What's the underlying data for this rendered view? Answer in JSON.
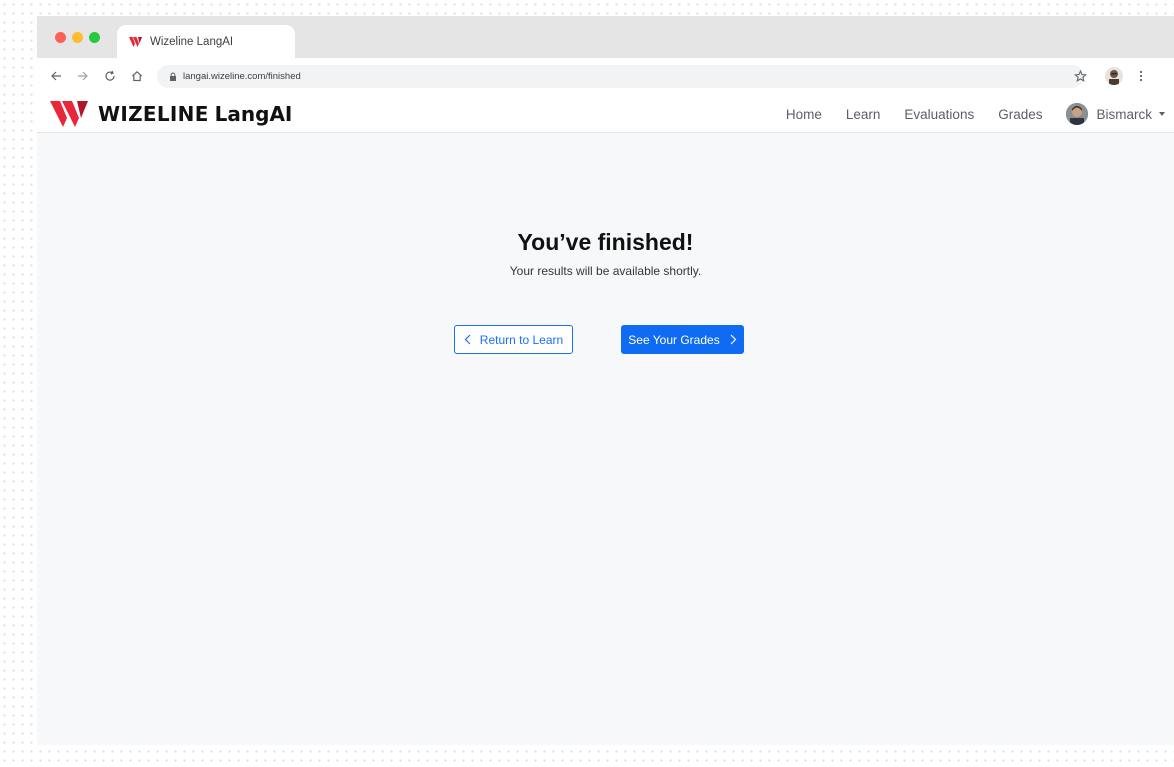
{
  "browser": {
    "tab_title": "Wizeline LangAI",
    "url": "langai.wizeline.com/finished"
  },
  "app": {
    "logo_primary": "WIZELINE",
    "logo_secondary": "LangAI",
    "nav": [
      {
        "label": "Home"
      },
      {
        "label": "Learn"
      },
      {
        "label": "Evaluations"
      },
      {
        "label": "Grades"
      }
    ],
    "user_name": "Bismarck"
  },
  "main": {
    "title": "You’ve finished!",
    "subtitle": "Your results will be available shortly.",
    "return_label": "Return to Learn",
    "grades_label": "See Your Grades"
  },
  "icons": [
    "back-arrow-icon",
    "forward-arrow-icon",
    "reload-icon",
    "home-icon",
    "lock-icon",
    "bookmark-star-icon",
    "menu-dots-icon",
    "wizeline-logo-icon",
    "chevron-left-icon",
    "chevron-right-icon",
    "caret-down-icon"
  ],
  "colors": {
    "brand_red": "#e8283a",
    "primary_blue": "#0f6cf2"
  }
}
